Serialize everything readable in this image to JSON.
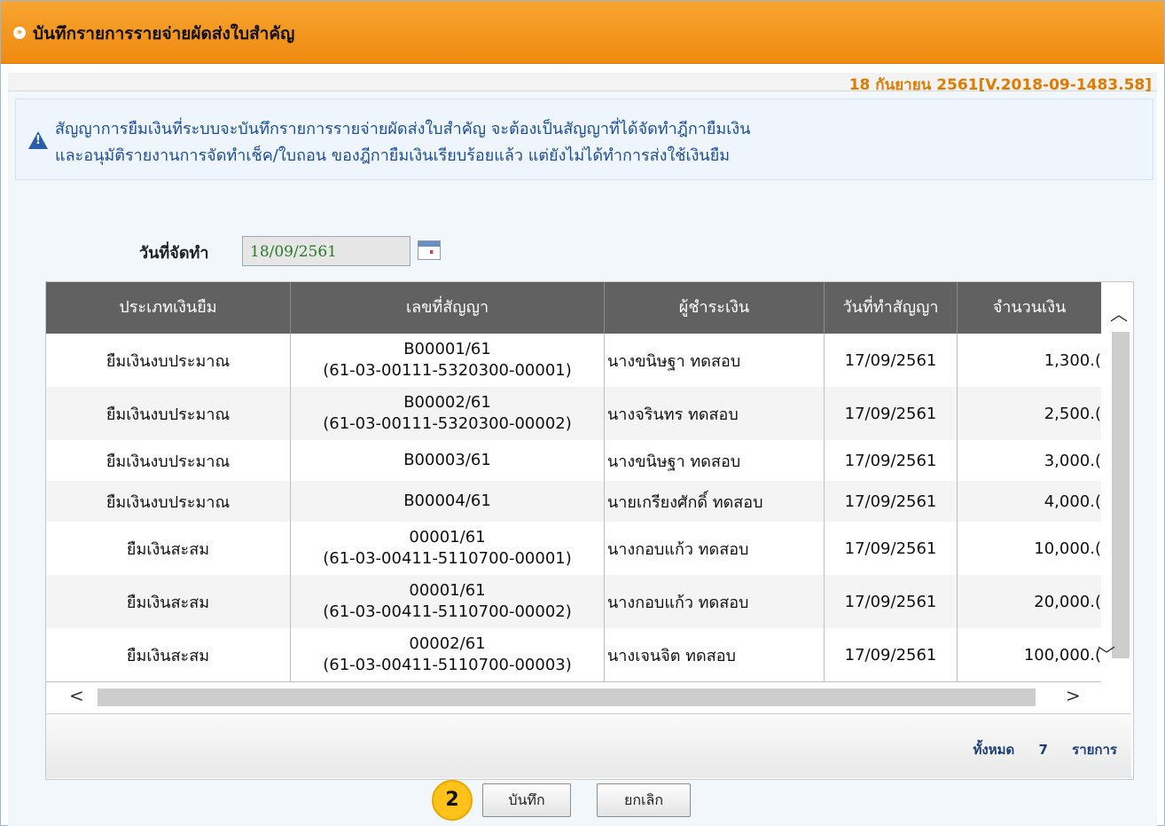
{
  "window": {
    "title": "บันทึกรายการรายจ่ายผัดส่งใบสำคัญ",
    "title_bullet": "»"
  },
  "version_line": "18 กันยายน 2561[V.2018-09-1483.58]",
  "notice": {
    "icon": "warning-triangle-icon",
    "line1": "สัญญาการยืมเงินที่ระบบจะบันทึกรายการรายจ่ายผัดส่งใบสำคัญ จะต้องเป็นสัญญาที่ได้จัดทำฎีกายืมเงิน",
    "line2": "และอนุมัติรายงานการจัดทำเช็ค/ใบถอน ของฎีกายืมเงินเรียบร้อยแล้ว แต่ยังไม่ได้ทำการส่งใช้เงินยืม"
  },
  "form": {
    "date_label": "วันที่จัดทำ",
    "date_value": "18/09/2561",
    "calendar_icon": "calendar-icon"
  },
  "table": {
    "headers": [
      "ประเภทเงินยืม",
      "เลขที่สัญญา",
      "ผู้ชำระเงิน",
      "วันที่ทำสัญญา",
      "จำนวนเงิน"
    ],
    "rows": [
      {
        "type": "ยืมเงินงบประมาณ",
        "no": "B00001/61",
        "ref": "(61-03-00111-5320300-00001)",
        "payer": "นางขนิษฐา ทดสอบ",
        "date": "17/09/2561",
        "amount": "1,300.("
      },
      {
        "type": "ยืมเงินงบประมาณ",
        "no": "B00002/61",
        "ref": "(61-03-00111-5320300-00002)",
        "payer": "นางจรินทร ทดสอบ",
        "date": "17/09/2561",
        "amount": "2,500.("
      },
      {
        "type": "ยืมเงินงบประมาณ",
        "no": "B00003/61",
        "ref": "",
        "payer": "นางขนิษฐา ทดสอบ",
        "date": "17/09/2561",
        "amount": "3,000.("
      },
      {
        "type": "ยืมเงินงบประมาณ",
        "no": "B00004/61",
        "ref": "",
        "payer": "นายเกรียงศักดิ์ ทดสอบ",
        "date": "17/09/2561",
        "amount": "4,000.("
      },
      {
        "type": "ยืมเงินสะสม",
        "no": "00001/61",
        "ref": "(61-03-00411-5110700-00001)",
        "payer": "นางกอบแก้ว ทดสอบ",
        "date": "17/09/2561",
        "amount": "10,000.("
      },
      {
        "type": "ยืมเงินสะสม",
        "no": "00001/61",
        "ref": "(61-03-00411-5110700-00002)",
        "payer": "นางกอบแก้ว ทดสอบ",
        "date": "17/09/2561",
        "amount": "20,000.("
      },
      {
        "type": "ยืมเงินสะสม",
        "no": "00002/61",
        "ref": "(61-03-00411-5110700-00003)",
        "payer": "นางเจนจิต ทดสอบ",
        "date": "17/09/2561",
        "amount": "100,000.("
      }
    ],
    "footer": {
      "total_label": "ทั้งหมด",
      "total_count": "7",
      "total_unit": "รายการ"
    }
  },
  "badge": "2",
  "buttons": {
    "save": "บันทึก",
    "cancel": "ยกเลิก"
  },
  "colors": {
    "titlebar": "#f08a10",
    "notice_text": "#1b4e9b",
    "version": "#e07b00",
    "header_bg": "#616161",
    "badge": "#ffc21a"
  }
}
